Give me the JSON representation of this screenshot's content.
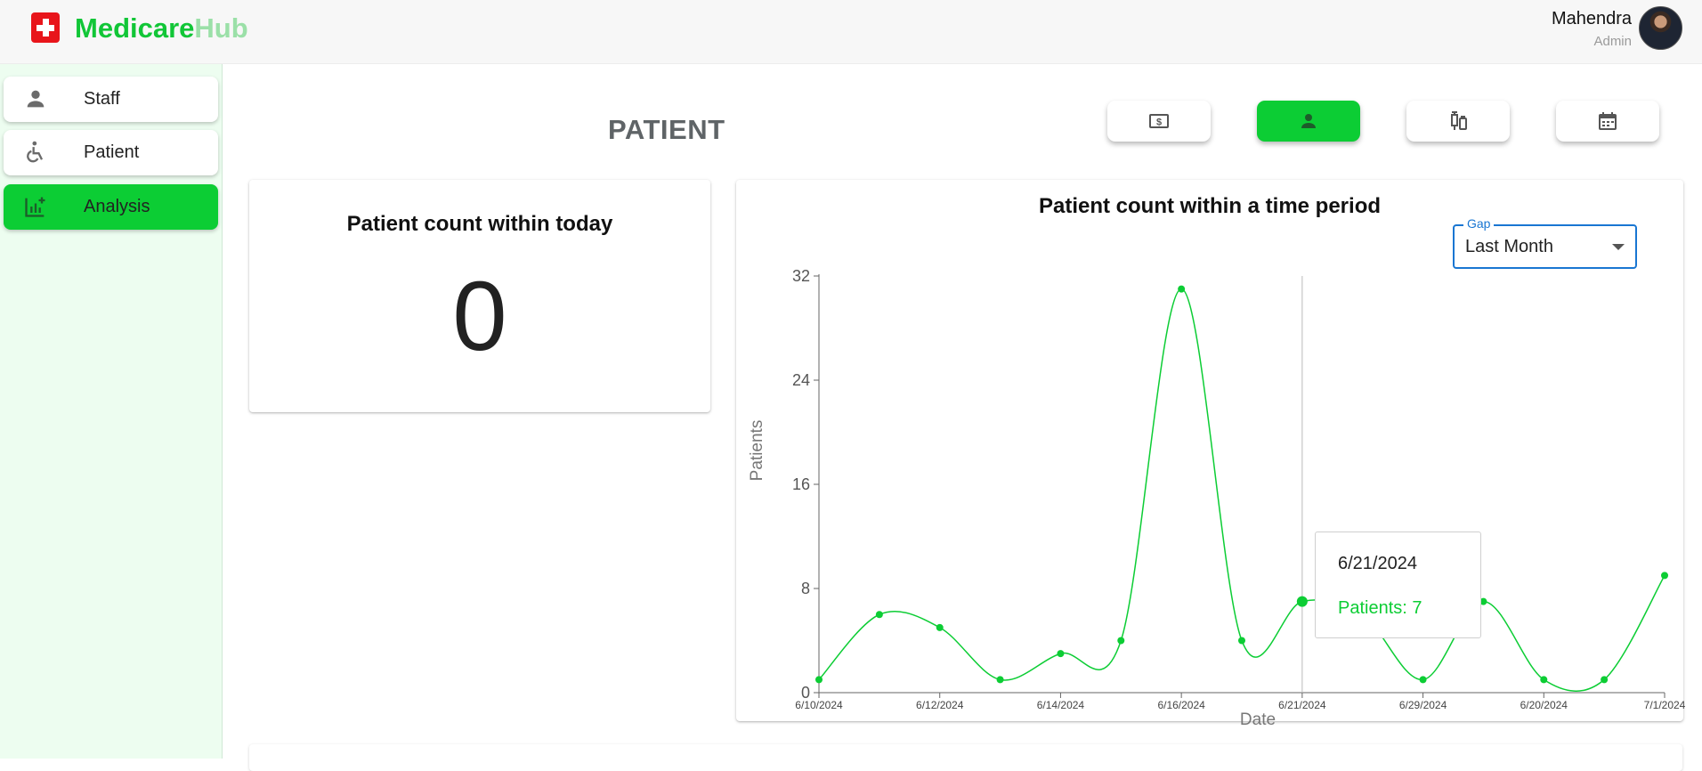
{
  "app": {
    "brand_primary": "Medicare",
    "brand_secondary": "Hub",
    "brand_color": "#11c637",
    "brand_color_light": "#9be0a8"
  },
  "user": {
    "name": "Mahendra",
    "role": "Admin"
  },
  "sidebar": {
    "items": [
      {
        "label": "Staff",
        "icon": "person-icon",
        "active": false
      },
      {
        "label": "Patient",
        "icon": "accessible-icon",
        "active": false
      },
      {
        "label": "Analysis",
        "icon": "analytics-icon",
        "active": true
      }
    ]
  },
  "page": {
    "title": "PATIENT"
  },
  "tabs": [
    {
      "icon": "payments-icon",
      "active": false
    },
    {
      "icon": "person-icon",
      "active": true
    },
    {
      "icon": "vaccines-icon",
      "active": false
    },
    {
      "icon": "calendar-icon",
      "active": false
    }
  ],
  "today_card": {
    "title": "Patient count within today",
    "value": "0"
  },
  "period_card": {
    "title": "Patient count within a time period",
    "gap": {
      "legend": "Gap",
      "value": "Last Month"
    },
    "tooltip": {
      "date": "6/21/2024",
      "label": "Patients: 7"
    }
  },
  "chart_data": {
    "type": "line",
    "xlabel": "Date",
    "ylabel": "Patients",
    "ylim": [
      0,
      32
    ],
    "yticks": [
      0,
      8,
      16,
      24,
      32
    ],
    "line_color": "#0ccd34",
    "curve": "smooth",
    "grid": false,
    "x_tick_labels": [
      "6/10/2024",
      "6/12/2024",
      "6/14/2024",
      "6/16/2024",
      "6/21/2024",
      "6/29/2024",
      "6/20/2024",
      "7/1/2024"
    ],
    "series": [
      {
        "values": [
          1,
          6,
          5,
          1,
          3,
          4,
          31,
          4,
          7,
          6,
          1,
          7,
          1,
          1,
          9
        ]
      }
    ],
    "active_index": 8
  }
}
